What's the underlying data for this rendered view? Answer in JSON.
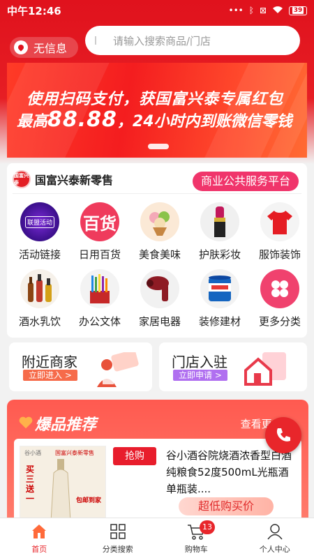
{
  "status_bar": {
    "time": "中午12:46",
    "battery": "39"
  },
  "header": {
    "location": "无信息",
    "search_placeholder": "请输入搜索商品/门店"
  },
  "banner": {
    "line1": "使用扫码支付，获国富兴泰专属红包",
    "line2_prefix": "最高",
    "line2_amount": "88.88",
    "line2_suffix": "，24小时内到账微信零钱"
  },
  "store": {
    "name": "国富兴泰新零售",
    "logo_text": "国富兴泰",
    "platform_button": "商业公共服务平台"
  },
  "categories": [
    {
      "label": "活动链接",
      "icon": "activity-link-icon",
      "badge": "联盟活动"
    },
    {
      "label": "日用百货",
      "icon": "daily-goods-icon",
      "badge": "百货"
    },
    {
      "label": "美食美味",
      "icon": "food-icon"
    },
    {
      "label": "护肤彩妆",
      "icon": "cosmetics-icon"
    },
    {
      "label": "服饰装饰",
      "icon": "clothing-icon"
    },
    {
      "label": "酒水乳饮",
      "icon": "drinks-icon"
    },
    {
      "label": "办公文体",
      "icon": "stationery-icon"
    },
    {
      "label": "家居电器",
      "icon": "appliance-icon"
    },
    {
      "label": "装修建材",
      "icon": "building-materials-icon"
    },
    {
      "label": "更多分类",
      "icon": "more-categories-icon"
    }
  ],
  "nearby": {
    "title": "附近商家",
    "sub": "立即进入 >"
  },
  "join": {
    "title": "门店入驻",
    "sub": "立即申请 >"
  },
  "hot": {
    "title": "爆品推荐",
    "more": "查看更多 >",
    "product": {
      "tag": "抢购",
      "name": "谷小酒谷院烧酒浓香型白酒纯粮食52度500mL光瓶酒单瓶装....",
      "cta": "超低购买价",
      "image_brand": "谷小酒",
      "image_logo": "国富兴泰新零售",
      "image_promo": "买三送一",
      "image_ship": "包邮到家"
    }
  },
  "tabs": [
    {
      "label": "首页",
      "icon": "home-icon",
      "active": true
    },
    {
      "label": "分类搜索",
      "icon": "category-search-icon",
      "active": false
    },
    {
      "label": "购物车",
      "icon": "cart-icon",
      "active": false
    },
    {
      "label": "个人中心",
      "icon": "profile-icon",
      "active": false
    }
  ],
  "cart_count": "13",
  "colors": {
    "brand_red": "#e0121d",
    "pink": "#f0356b",
    "hot_bg": "#ff5a50"
  }
}
